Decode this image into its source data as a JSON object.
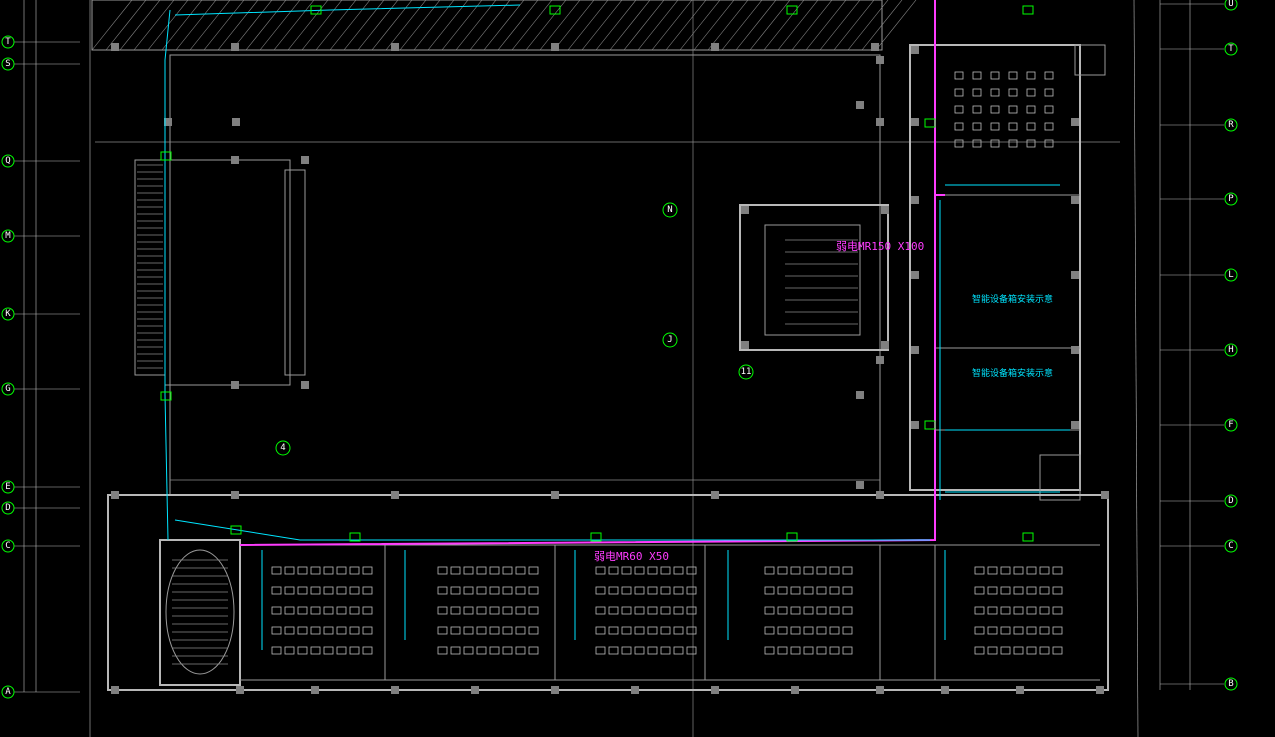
{
  "axes": {
    "left": [
      "T",
      "S",
      "Q",
      "M",
      "K",
      "G",
      "E",
      "D",
      "C",
      "A"
    ],
    "right": [
      "U",
      "T",
      "R",
      "P",
      "L",
      "H",
      "F",
      "D",
      "C",
      "B"
    ],
    "interior": [
      "N",
      "J",
      "11",
      "4"
    ]
  },
  "labels": {
    "trunk_upper": "弱电MR150 X100",
    "trunk_lower": "弱电MR60 X50",
    "room_1": "智能设备箱安装示意",
    "room_2": "智能设备箱安装示意"
  },
  "colors": {
    "background": "#000000",
    "weak_trunk": "#ff3cff",
    "pipe": "#00e5ff",
    "axis": "#00ff00",
    "wall": "#9a9a9a"
  }
}
